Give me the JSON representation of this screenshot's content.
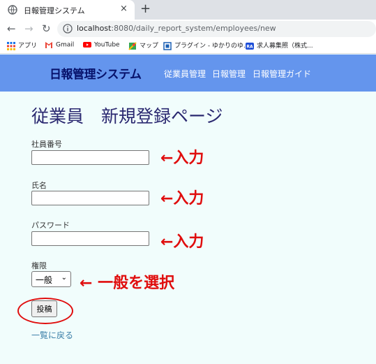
{
  "browser": {
    "tab_title": "日報管理システム",
    "tab_close": "×",
    "new_tab": "+",
    "url_host": "localhost",
    "url_rest": ":8080/daily_report_system/employees/new",
    "bookmarks": [
      "アプリ",
      "Gmail",
      "YouTube",
      "マップ",
      "プラグイン - ゆかりのゆ...",
      "求人募集照（株式..."
    ]
  },
  "header": {
    "brand": "日報管理システム",
    "nav": [
      "従業員管理",
      "日報管理",
      "日報管理ガイド"
    ],
    "color": "#6495ed"
  },
  "form": {
    "title": "従業員　新規登録ページ",
    "code_label": "社員番号",
    "name_label": "氏名",
    "password_label": "パスワード",
    "role_label": "権限",
    "role_selected": "一般",
    "submit_label": "投稿",
    "back_link": "一覧に戻る"
  },
  "annotations": {
    "code": "←入力",
    "name": "←入力",
    "password": "←入力",
    "role": "← 一般を選択",
    "color": "#e00d0d"
  }
}
